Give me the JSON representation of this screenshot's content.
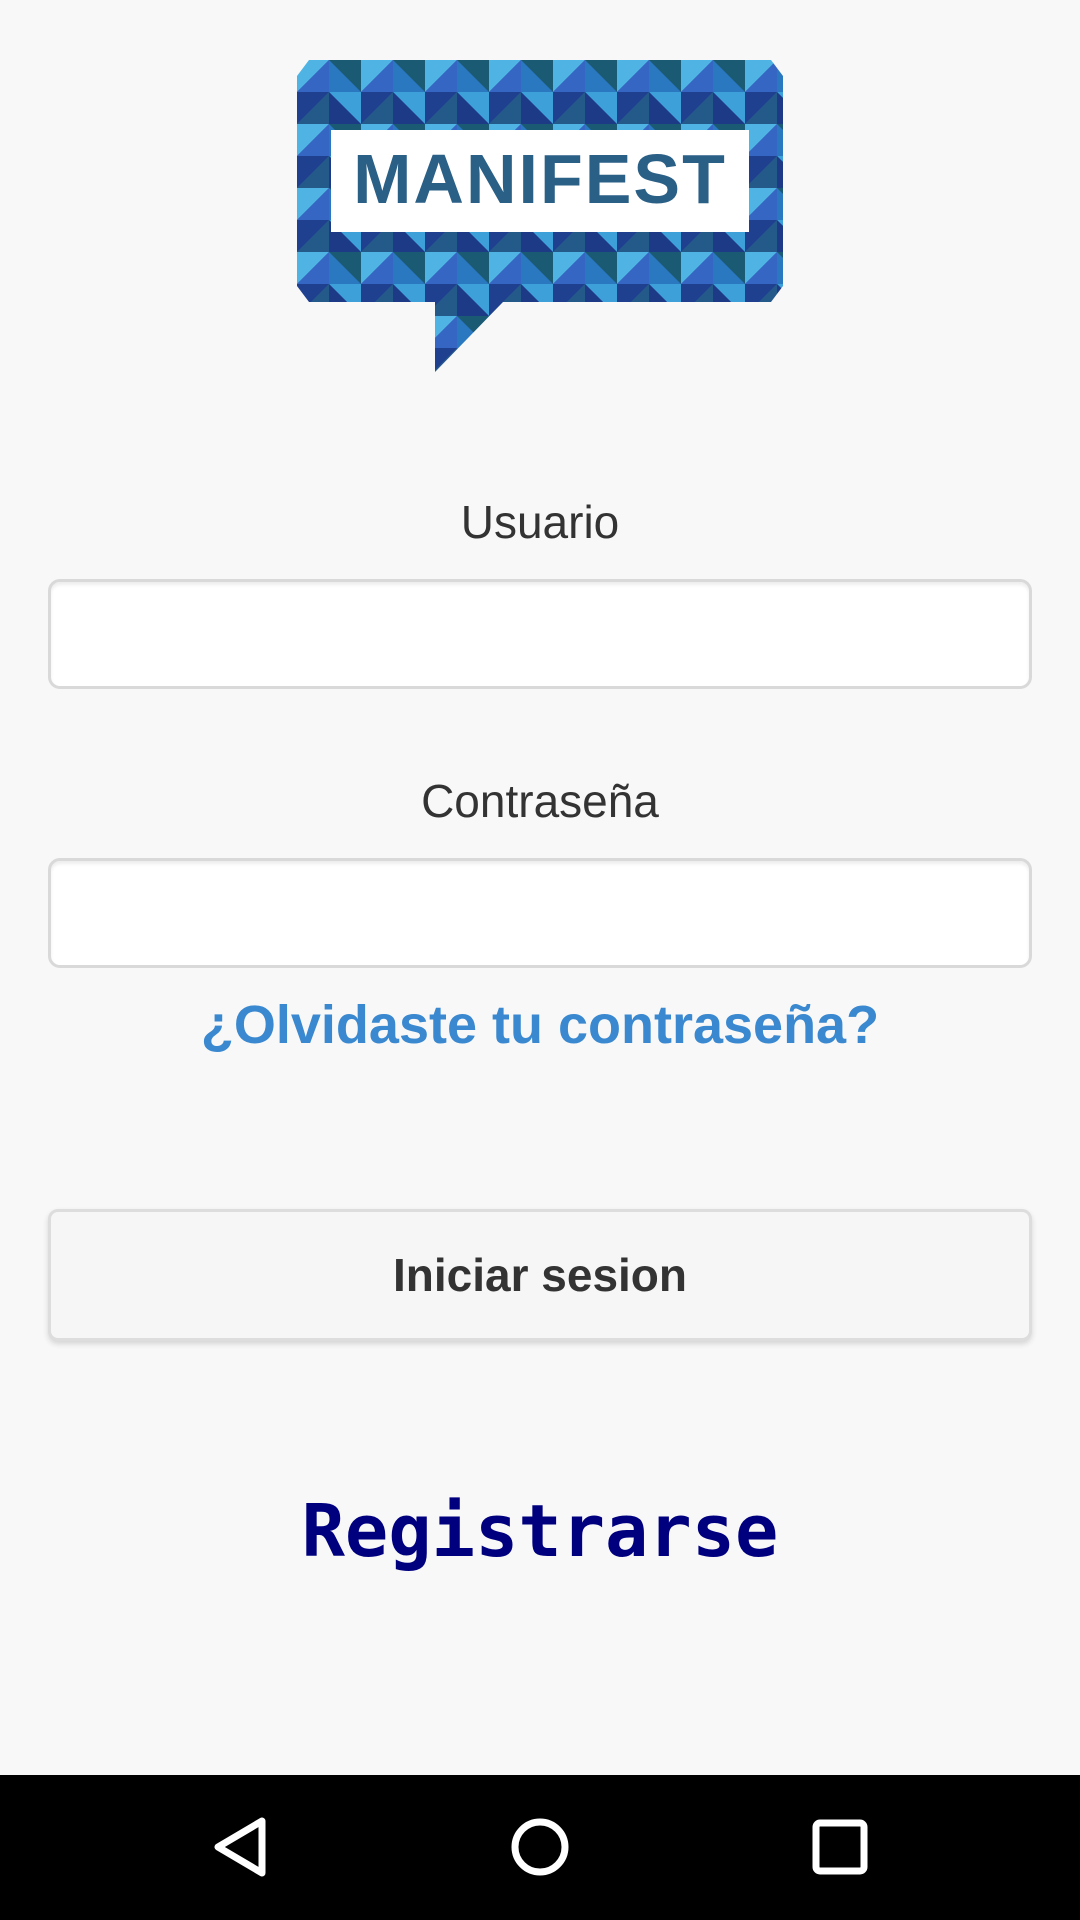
{
  "app": {
    "logo_text": "MANIFEST"
  },
  "login": {
    "username_label": "Usuario",
    "username_value": "",
    "password_label": "Contraseña",
    "password_value": "",
    "forgot_password": "¿Olvidaste tu contraseña?",
    "login_button": "Iniciar sesion",
    "register_link": "Registrarse"
  },
  "colors": {
    "background": "#f8f8f8",
    "link_blue": "#3a88cf",
    "register_navy": "#00007f",
    "logo_blue": "#2d4fa8",
    "logo_light_blue": "#4fb3e3",
    "logo_dark_teal": "#1a5a73"
  },
  "navigation_bar": {
    "buttons": [
      "back-icon",
      "home-icon",
      "recents-icon"
    ]
  }
}
